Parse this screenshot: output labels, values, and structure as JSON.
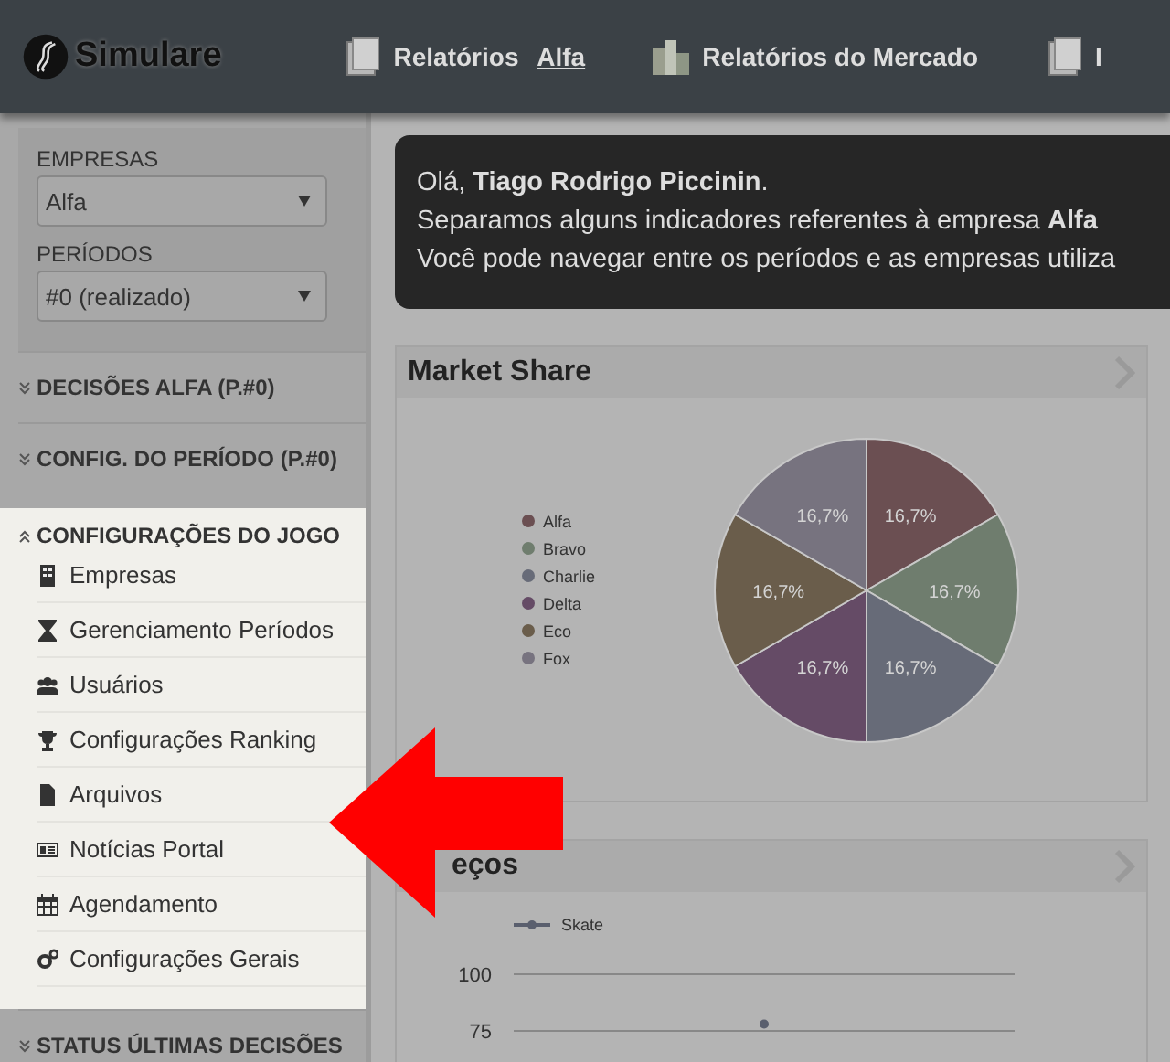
{
  "header": {
    "logo": "Simulare",
    "nav": [
      {
        "label": "Relatórios",
        "link": "Alfa"
      },
      {
        "label": "Relatórios do Mercado"
      },
      {
        "label": "I"
      }
    ]
  },
  "sidebar": {
    "filters": [
      {
        "label": "EMPRESAS",
        "value": "Alfa"
      },
      {
        "label": "PERÍODOS",
        "value": "#0 (realizado)"
      }
    ],
    "sections": [
      {
        "title": "DECISÕES ALFA (P.#0)",
        "expanded": false,
        "spotlight": false
      },
      {
        "title": "CONFIG. DO PERÍODO (P.#0)",
        "expanded": false,
        "spotlight": false
      },
      {
        "title": "CONFIGURAÇÕES DO JOGO",
        "expanded": true,
        "spotlight": true,
        "items": [
          "Empresas",
          "Gerenciamento Períodos",
          "Usuários",
          "Configurações Ranking",
          "Arquivos",
          "Notícias Portal",
          "Agendamento",
          "Configurações Gerais"
        ]
      },
      {
        "title": "STATUS ÚLTIMAS DECISÕES",
        "expanded": false,
        "spotlight": false
      }
    ]
  },
  "welcome": [
    "Olá, **Tiago Rodrigo Piccinin**.",
    "Separamos alguns indicadores referentes à empresa **Alfa**",
    "Você pode navegar entre os períodos e as empresas utiliza"
  ],
  "panels": [
    {
      "title": "Market Share",
      "chart_data": {
        "type": "pie",
        "legend": "left",
        "categories": [
          "Alfa",
          "Bravo",
          "Charlie",
          "Delta",
          "Eco",
          "Fox"
        ],
        "values": [
          16.7,
          16.7,
          16.7,
          16.7,
          16.7,
          16.7
        ],
        "colors": [
          "#6b4f52",
          "#6f7d6e",
          "#676b78",
          "#654b66",
          "#6a5d4b",
          "#77737f"
        ],
        "value_labels": [
          "16,7%",
          "16,7%",
          "16,7%",
          "16,7%",
          "16,7%",
          "16,7%"
        ]
      }
    },
    {
      "title": "eços",
      "chart_data": {
        "type": "line",
        "legend": "top",
        "series": [
          {
            "name": "Skate",
            "color": "#5a5f6e",
            "marker": "circle",
            "values": [
              78
            ]
          }
        ],
        "ylim": [
          75,
          100
        ],
        "yticks": [
          75,
          100
        ]
      }
    }
  ]
}
